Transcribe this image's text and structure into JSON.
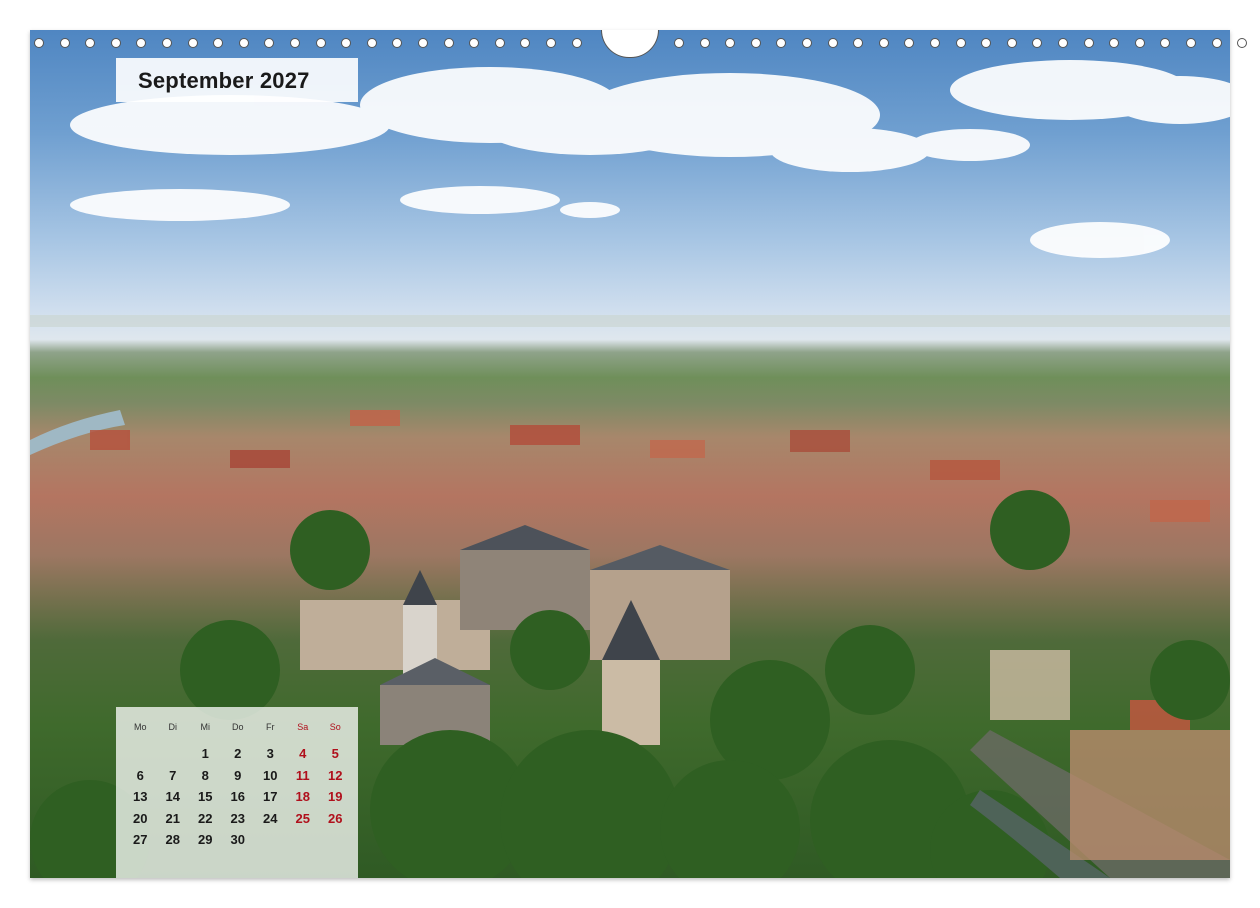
{
  "calendar": {
    "title": "September 2027",
    "weekdays": [
      "Mo",
      "Di",
      "Mi",
      "Do",
      "Fr",
      "Sa",
      "So"
    ],
    "weeks": [
      [
        "",
        "",
        "1",
        "2",
        "3",
        "4",
        "5"
      ],
      [
        "6",
        "7",
        "8",
        "9",
        "10",
        "11",
        "12"
      ],
      [
        "13",
        "14",
        "15",
        "16",
        "17",
        "18",
        "19"
      ],
      [
        "20",
        "21",
        "22",
        "23",
        "24",
        "25",
        "26"
      ],
      [
        "27",
        "28",
        "29",
        "30",
        "",
        "",
        ""
      ]
    ],
    "colors": {
      "weekend": "#b0101c",
      "text": "#1a1a1a"
    }
  }
}
